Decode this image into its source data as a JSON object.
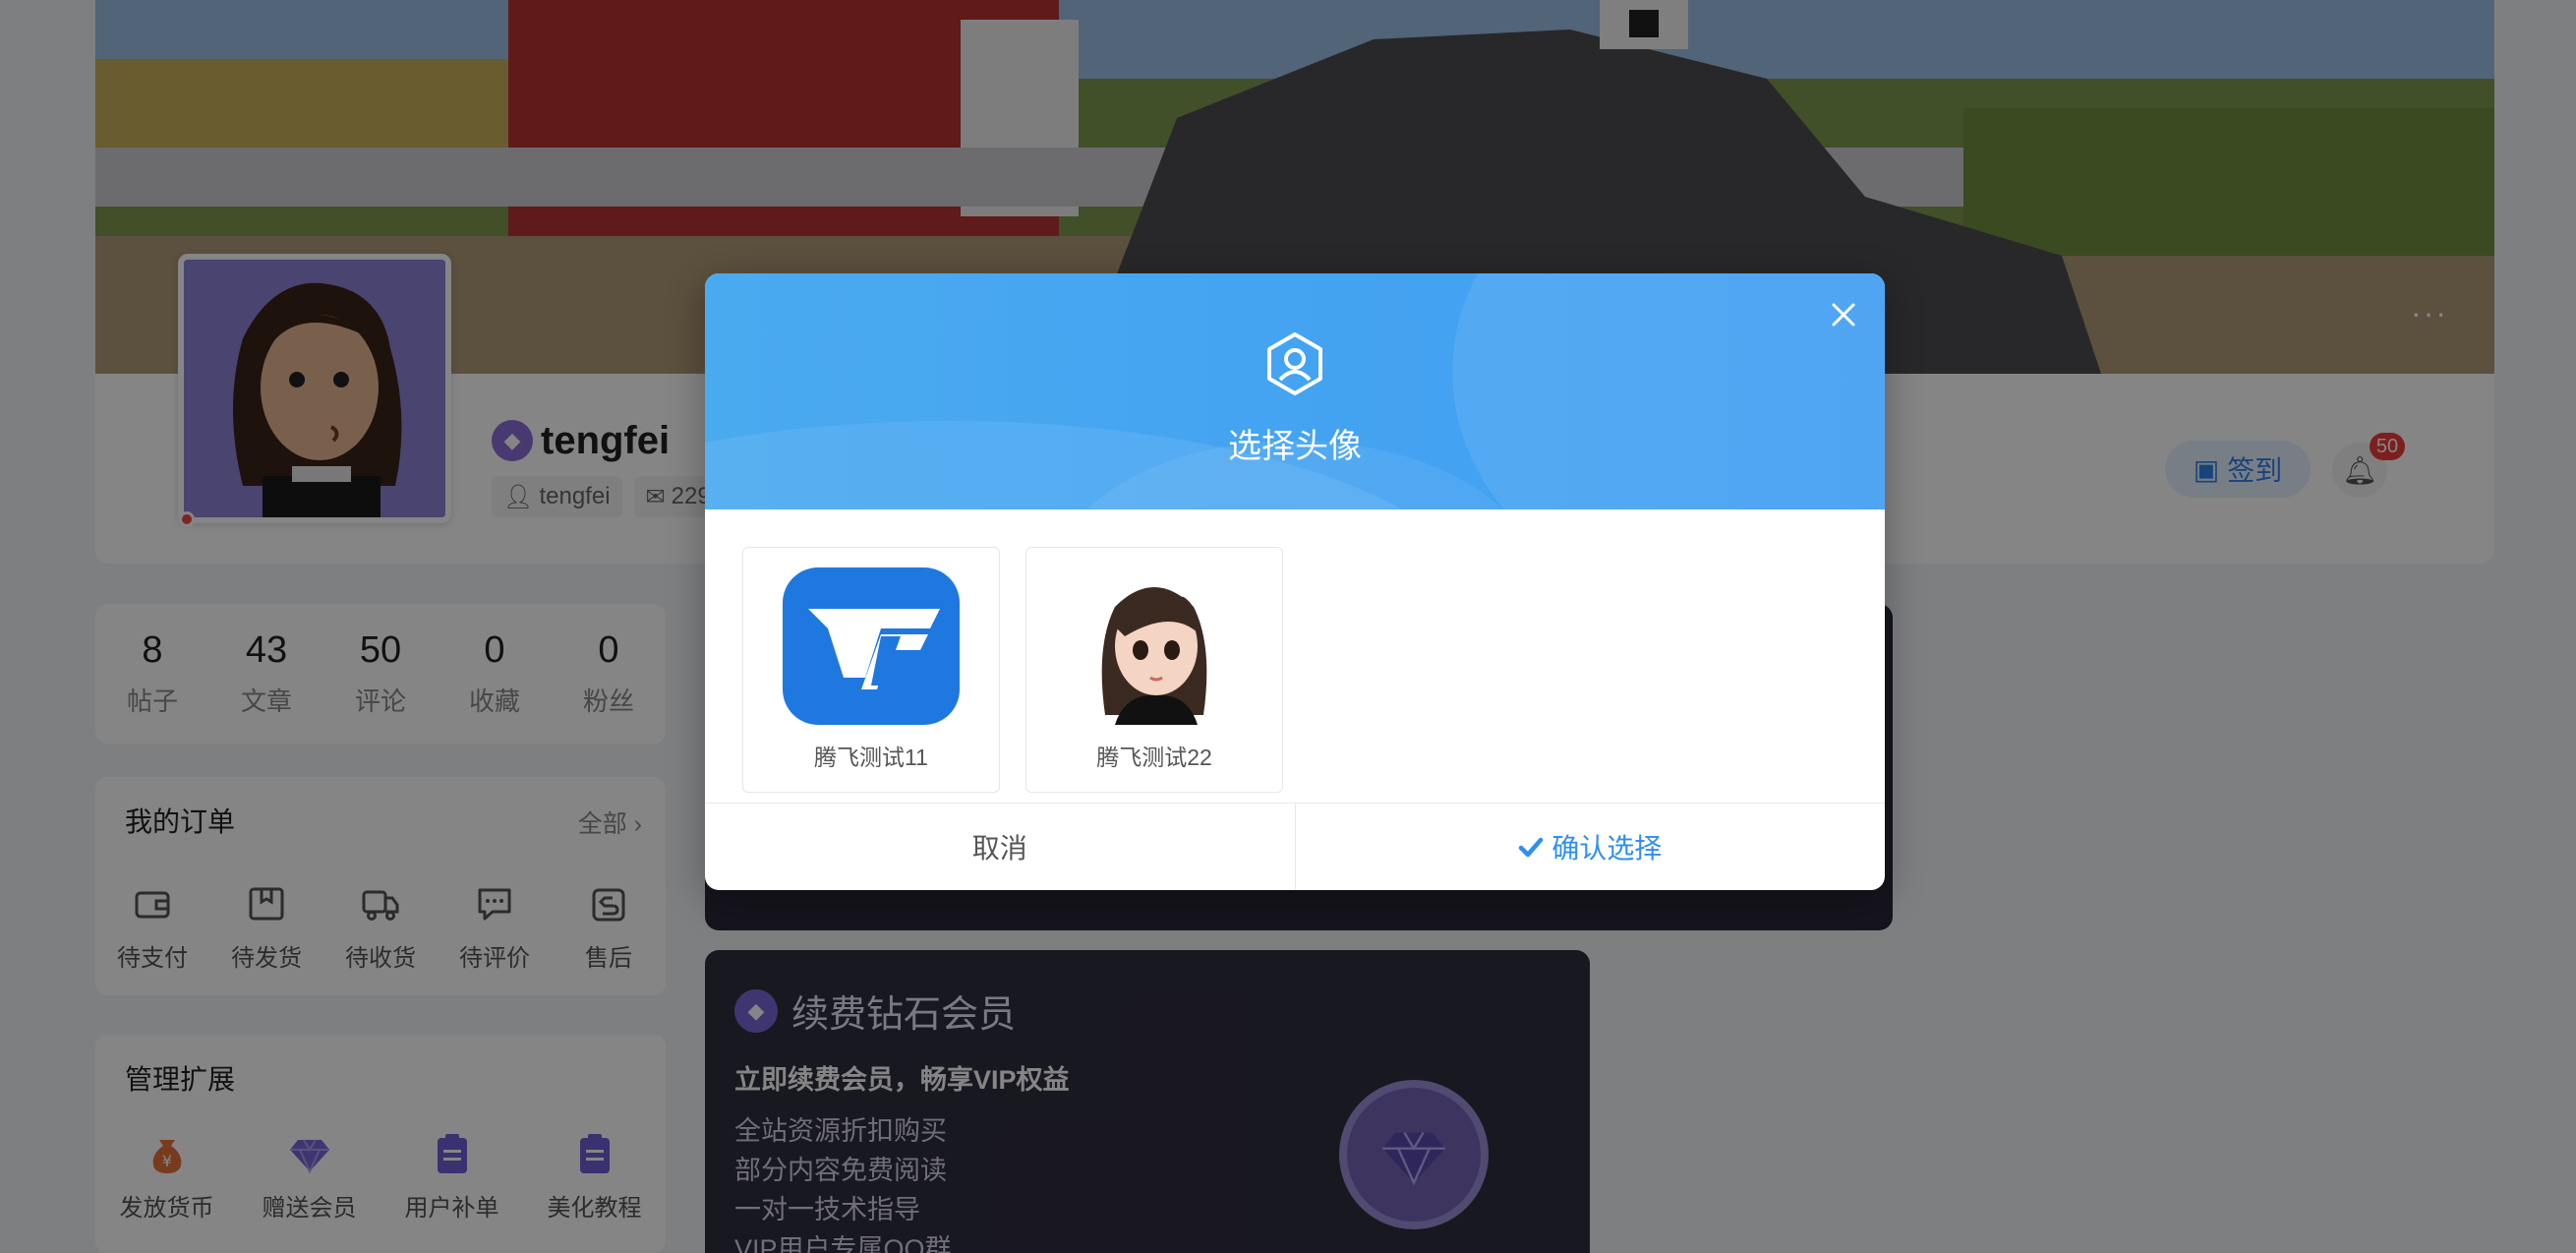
{
  "profile": {
    "username": "tengfei",
    "handle": "tengfei",
    "email_partial": "229",
    "checkin_label": "签到",
    "notification_count": "50",
    "more_label": "···"
  },
  "stats": [
    {
      "num": "8",
      "label": "帖子"
    },
    {
      "num": "43",
      "label": "文章"
    },
    {
      "num": "50",
      "label": "评论"
    },
    {
      "num": "0",
      "label": "收藏"
    },
    {
      "num": "0",
      "label": "粉丝"
    }
  ],
  "orders": {
    "title": "我的订单",
    "more": "全部 ›",
    "items": [
      {
        "label": "待支付",
        "icon": "wallet-icon"
      },
      {
        "label": "待发货",
        "icon": "package-icon"
      },
      {
        "label": "待收货",
        "icon": "truck-icon"
      },
      {
        "label": "待评价",
        "icon": "comment-icon"
      },
      {
        "label": "售后",
        "icon": "return-icon"
      }
    ]
  },
  "manage": {
    "title": "管理扩展",
    "items": [
      {
        "label": "发放货币",
        "icon": "money-bag-icon"
      },
      {
        "label": "赠送会员",
        "icon": "diamond-icon"
      },
      {
        "label": "用户补单",
        "icon": "clipboard-icon"
      },
      {
        "label": "美化教程",
        "icon": "clipboard-icon"
      }
    ]
  },
  "vip": {
    "title": "续费钻石会员",
    "subtitle": "立即续费会员，畅享VIP权益",
    "perks": [
      "全站资源折扣购买",
      "部分内容免费阅读",
      "一对一技术指导",
      "VIP用户专属QQ群"
    ]
  },
  "modal": {
    "title": "选择头像",
    "options": [
      {
        "name": "腾飞测试11",
        "kind": "logo"
      },
      {
        "name": "腾飞测试22",
        "kind": "girl"
      }
    ],
    "cancel_label": "取消",
    "confirm_label": "确认选择"
  },
  "colors": {
    "modal_header": "#42a3f1",
    "confirm_text": "#2f8ff0",
    "badge_red": "#f23c3c",
    "vip_purple": "#8a6fd8"
  }
}
